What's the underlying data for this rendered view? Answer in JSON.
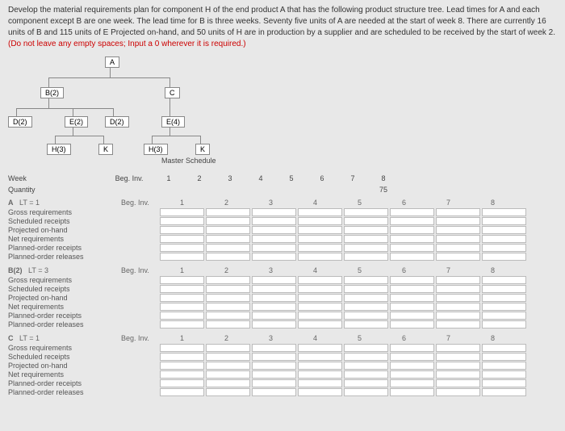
{
  "problem": {
    "text": "Develop the material requirements plan for component H of the end product A that has the following product structure tree. Lead times for A and each component except B are one week. The lead time for B is three weeks. Seventy five units of A are needed at the start of week 8. There are currently 16 units of B and 115 units of E Projected on-hand, and 50 units of H are in production by a supplier and are scheduled to be received by the start of week 2. ",
    "instruction": "(Do not leave any empty spaces; Input a 0 wherever it is required.)"
  },
  "tree": {
    "A": "A",
    "B2": "B(2)",
    "C": "C",
    "D2a": "D(2)",
    "E2": "E(2)",
    "D2b": "D(2)",
    "E4": "E(4)",
    "H3a": "H(3)",
    "K1": "K",
    "H3b": "H(3)",
    "K2": "K"
  },
  "master": {
    "title": "Master Schedule",
    "week_label": "Week",
    "qty_label": "Quantity",
    "beg_inv": "Beg. Inv.",
    "weeks": [
      "1",
      "2",
      "3",
      "4",
      "5",
      "6",
      "7",
      "8"
    ],
    "qty": [
      "",
      "",
      "",
      "",
      "",
      "",
      "",
      "75"
    ]
  },
  "mrp_rows": [
    "Gross requirements",
    "Scheduled receipts",
    "Projected on-hand",
    "Net requirements",
    "Planned-order receipts",
    "Planned-order releases"
  ],
  "blocks": [
    {
      "name": "A",
      "lt": "LT = 1",
      "beg": "Beg. Inv.",
      "weeks": [
        "1",
        "2",
        "3",
        "4",
        "5",
        "6",
        "7",
        "8"
      ]
    },
    {
      "name": "B(2)",
      "lt": "LT = 3",
      "beg": "Beg. Inv.",
      "weeks": [
        "1",
        "2",
        "3",
        "4",
        "5",
        "6",
        "7",
        "8"
      ]
    },
    {
      "name": "C",
      "lt": "LT = 1",
      "beg": "Beg. Inv.",
      "weeks": [
        "1",
        "2",
        "3",
        "4",
        "5",
        "6",
        "7",
        "8"
      ]
    }
  ]
}
